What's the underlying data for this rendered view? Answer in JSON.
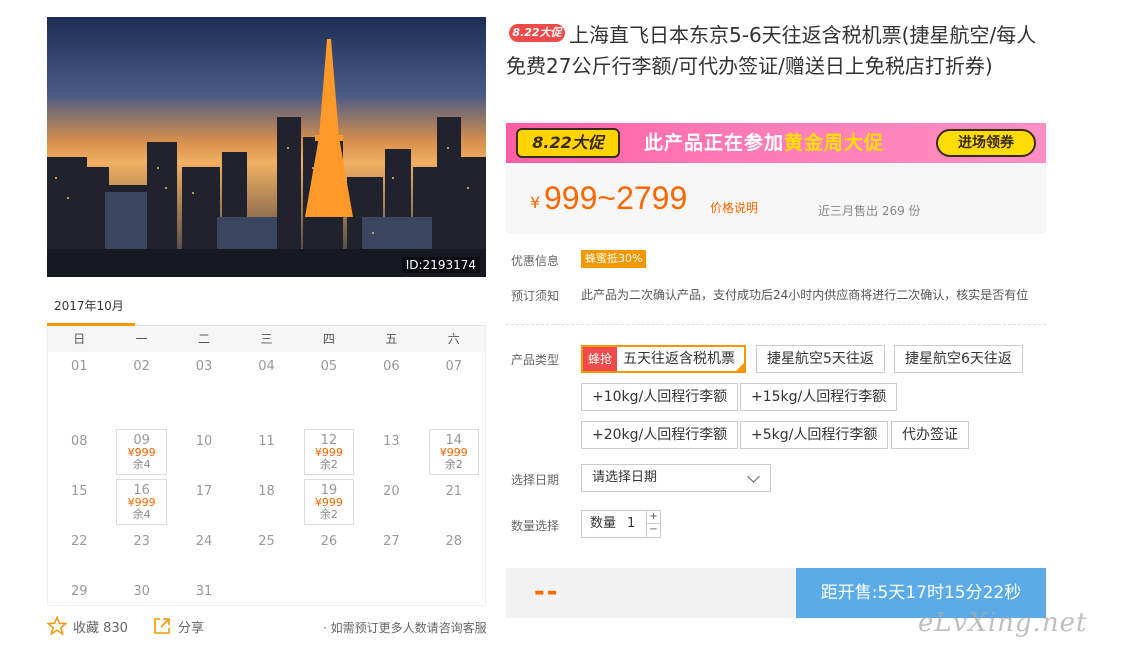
{
  "photo": {
    "id_label": "ID:2193174"
  },
  "calendar": {
    "month": "2017年10月",
    "weekdays": [
      "日",
      "一",
      "二",
      "三",
      "四",
      "五",
      "六"
    ],
    "days": [
      {
        "d": "01"
      },
      {
        "d": "02"
      },
      {
        "d": "03"
      },
      {
        "d": "04"
      },
      {
        "d": "05"
      },
      {
        "d": "06"
      },
      {
        "d": "07"
      },
      {
        "d": "08"
      },
      {
        "d": "09",
        "price": "¥999",
        "stock": "余4"
      },
      {
        "d": "10"
      },
      {
        "d": "11"
      },
      {
        "d": "12",
        "price": "¥999",
        "stock": "余2"
      },
      {
        "d": "13"
      },
      {
        "d": "14",
        "price": "¥999",
        "stock": "余2"
      },
      {
        "d": "15"
      },
      {
        "d": "16",
        "price": "¥999",
        "stock": "余4"
      },
      {
        "d": "17"
      },
      {
        "d": "18"
      },
      {
        "d": "19",
        "price": "¥999",
        "stock": "余2"
      },
      {
        "d": "20"
      },
      {
        "d": "21"
      },
      {
        "d": "22"
      },
      {
        "d": "23"
      },
      {
        "d": "24"
      },
      {
        "d": "25"
      },
      {
        "d": "26"
      },
      {
        "d": "27"
      },
      {
        "d": "28"
      },
      {
        "d": "29"
      },
      {
        "d": "30"
      },
      {
        "d": "31"
      }
    ]
  },
  "footer": {
    "favorite_label": "收藏 830",
    "share_label": "分享",
    "consult_text": "· 如需预订更多人数请咨询客服"
  },
  "product": {
    "badge": "8.22大促",
    "title": "上海直飞日本东京5-6天往返含税机票(捷星航空/每人免费27公斤行李额/可代办签证/赠送日上免税店打折券)"
  },
  "promo": {
    "logo": "8.22大促",
    "text_before": "此产品正在参加",
    "text_highlight": "黄金周大促",
    "button": "进场领券"
  },
  "price": {
    "yen": "¥",
    "range": "999~2799",
    "note": "价格说明",
    "sold": "近三月售出 269 份"
  },
  "info": {
    "discount_label": "优惠信息",
    "discount_tag": "蜂蜜抵30%",
    "notice_label": "预订须知",
    "notice_text": "此产品为二次确认产品，支付成功后24小时内供应商将进行二次确认，核实是否有位"
  },
  "options": {
    "label": "产品类型",
    "selected_tag": "蜂抢",
    "items": [
      "五天往返含税机票",
      "捷星航空5天往返",
      "捷星航空6天往返",
      "+10kg/人回程行李额",
      "+15kg/人回程行李额",
      "+20kg/人回程行李额",
      "+5kg/人回程行李额",
      "代办签证"
    ]
  },
  "date": {
    "label": "选择日期",
    "placeholder": "请选择日期"
  },
  "quantity": {
    "label": "数量选择",
    "prefix": "数量",
    "value": "1",
    "plus": "+",
    "minus": "−"
  },
  "buy": {
    "price": "--",
    "countdown": "距开售:5天17时15分22秒"
  },
  "watermark": "eLvXing.net",
  "colors": {
    "accent": "#ff6600",
    "promo_pink": "#ff79b4",
    "countdown_blue": "#5aabe8",
    "badge_red": "#f04a4a"
  }
}
